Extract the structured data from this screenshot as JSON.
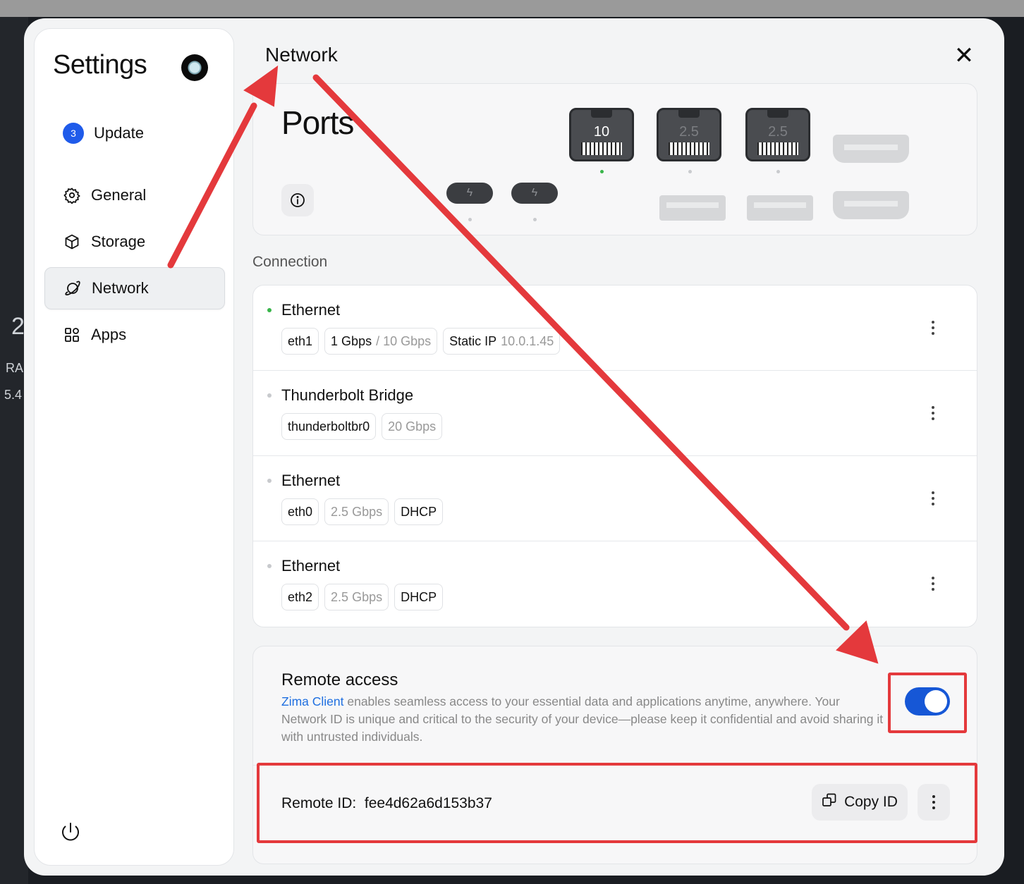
{
  "background": {
    "left_texts": [
      "2",
      "RA",
      "5.4"
    ]
  },
  "sidebar": {
    "title": "Settings",
    "items": [
      {
        "label": "Update",
        "badge": "3",
        "icon": "badge"
      },
      {
        "label": "General",
        "icon": "gear-icon"
      },
      {
        "label": "Storage",
        "icon": "cube-icon"
      },
      {
        "label": "Network",
        "icon": "planet-icon",
        "active": true
      },
      {
        "label": "Apps",
        "icon": "apps-grid-icon"
      }
    ],
    "power_icon": "power-icon"
  },
  "header": {
    "title": "Network",
    "close_icon": "close-icon"
  },
  "ports": {
    "title": "Ports",
    "rj45": [
      {
        "speed": "10",
        "active": true
      },
      {
        "speed": "2.5",
        "active": false
      },
      {
        "speed": "2.5",
        "active": false
      }
    ],
    "thunderbolt_glyph": "ϟ"
  },
  "connection": {
    "label": "Connection",
    "rows": [
      {
        "name": "Ethernet",
        "connected": true,
        "chips": [
          {
            "text": "eth1"
          },
          {
            "text": "1 Gbps",
            "muted": "/ 10 Gbps"
          },
          {
            "text": "Static IP",
            "muted": "10.0.1.45"
          }
        ]
      },
      {
        "name": "Thunderbolt Bridge",
        "connected": false,
        "chips": [
          {
            "text": "thunderboltbr0"
          },
          {
            "muted_only": "20 Gbps"
          }
        ]
      },
      {
        "name": "Ethernet",
        "connected": false,
        "chips": [
          {
            "text": "eth0"
          },
          {
            "muted_only": "2.5 Gbps"
          },
          {
            "text": "DHCP"
          }
        ]
      },
      {
        "name": "Ethernet",
        "connected": false,
        "chips": [
          {
            "text": "eth2"
          },
          {
            "muted_only": "2.5 Gbps"
          },
          {
            "text": "DHCP"
          }
        ]
      }
    ]
  },
  "remote": {
    "title": "Remote access",
    "link_text": "Zima Client",
    "description": " enables seamless access to your essential data and applications anytime, anywhere. Your Network ID is unique and critical to the security of your device—please keep it confidential and avoid sharing it with untrusted individuals.",
    "toggle_on": true,
    "remote_id_label": "Remote ID:",
    "remote_id_value": "fee4d62a6d153b37",
    "copy_label": "Copy ID"
  },
  "annotations": {
    "color": "#e4393c"
  }
}
